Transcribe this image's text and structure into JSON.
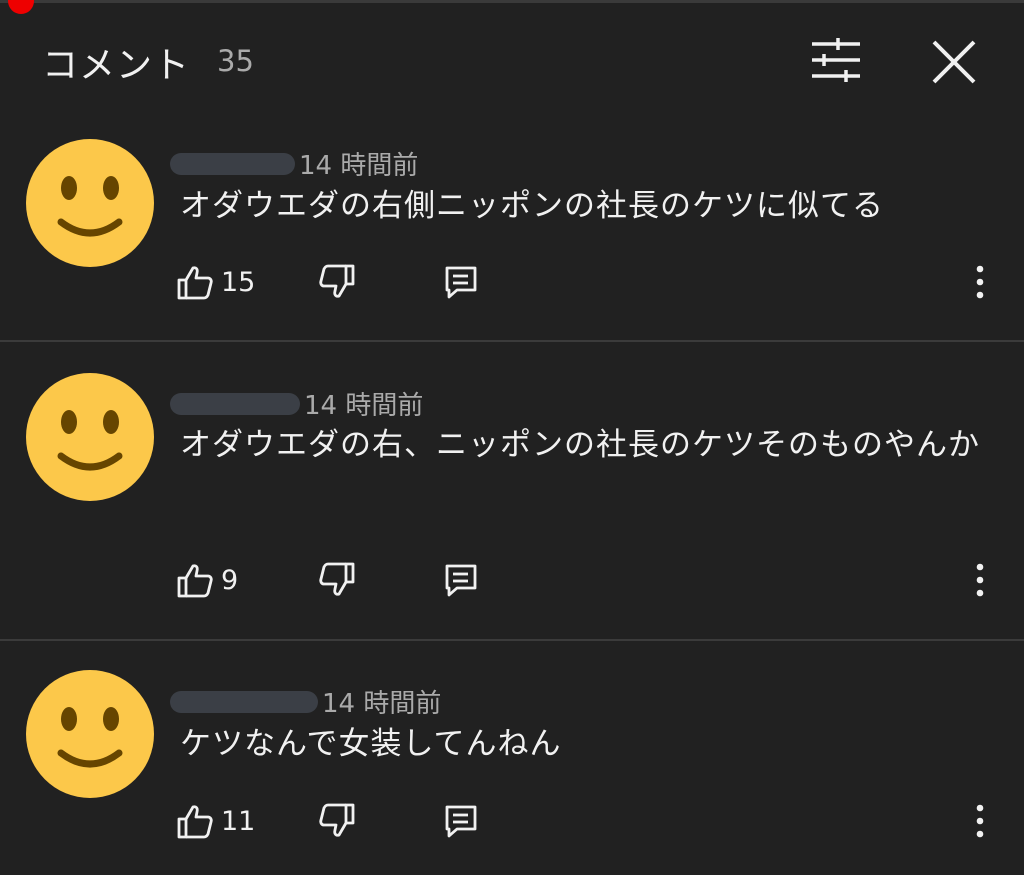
{
  "header": {
    "title": "コメント",
    "count": "35"
  },
  "comments": [
    {
      "time": "14 時間前",
      "text": "オダウエダの右側ニッポンの社長のケツに似てる",
      "likes": "15"
    },
    {
      "time": "14 時間前",
      "text": "オダウエダの右、ニッポンの社長のケツそのものやんか",
      "likes": "9"
    },
    {
      "time": "14 時間前",
      "text": "ケツなんで女装してんねん",
      "likes": "11"
    }
  ],
  "colors": {
    "background": "#212121",
    "text": "#f1f1f1",
    "muted": "#aaaaaa",
    "avatar": "#fcc84a",
    "divider": "#3b3b3b"
  },
  "icons": [
    "filter-icon",
    "close-icon",
    "smiley-avatar",
    "thumbs-up-icon",
    "thumbs-down-icon",
    "reply-icon",
    "more-vert-icon"
  ]
}
